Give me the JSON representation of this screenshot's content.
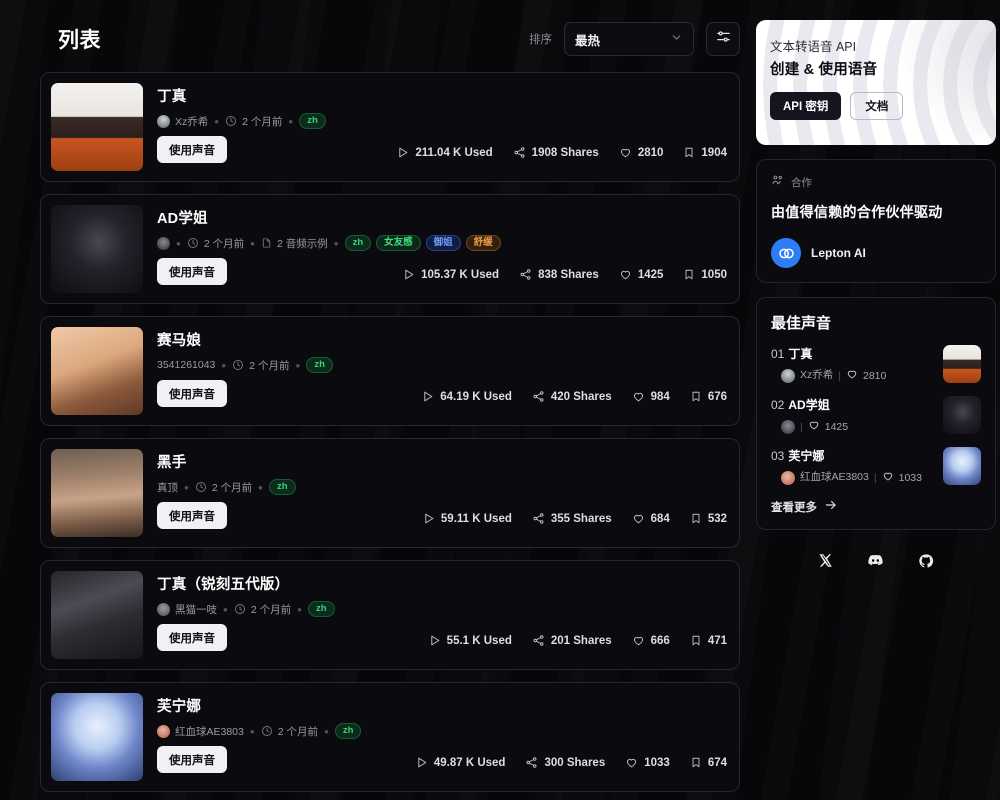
{
  "header": {
    "title": "列表",
    "sort_label": "排序",
    "sort_value": "最热",
    "chevron_icon": "chevron-down-icon",
    "filter_icon": "sliders-icon"
  },
  "list": {
    "items": [
      {
        "title": "丁真",
        "author": "Xz乔希",
        "has_author_avatar": true,
        "time": "2 个月前",
        "samples": "",
        "tags": [
          {
            "label": "zh",
            "style": "zh"
          }
        ],
        "use_button": "使用声音",
        "used": "211.04 K Used",
        "shares": "1908 Shares",
        "likes": "2810",
        "saves": "1904",
        "thumb_kind": "photo-man-orange"
      },
      {
        "title": "AD学姐",
        "author": "",
        "has_author_avatar": true,
        "time": "2 个月前",
        "samples": "2 音频示例",
        "tags": [
          {
            "label": "zh",
            "style": "zh"
          },
          {
            "label": "女友感",
            "style": "green"
          },
          {
            "label": "御姐",
            "style": "blue"
          },
          {
            "label": "舒缓",
            "style": "orange"
          }
        ],
        "use_button": "使用声音",
        "used": "105.37 K Used",
        "shares": "838 Shares",
        "likes": "1425",
        "saves": "1050",
        "thumb_kind": "anime-dark"
      },
      {
        "title": "赛马娘",
        "author": "3541261043",
        "has_author_avatar": false,
        "time": "2 个月前",
        "samples": "",
        "tags": [
          {
            "label": "zh",
            "style": "zh"
          }
        ],
        "use_button": "使用声音",
        "used": "64.19 K Used",
        "shares": "420 Shares",
        "likes": "984",
        "saves": "676",
        "thumb_kind": "anime-brown"
      },
      {
        "title": "黑手",
        "author": "真顶",
        "has_author_avatar": false,
        "time": "2 个月前",
        "samples": "",
        "tags": [
          {
            "label": "zh",
            "style": "zh"
          }
        ],
        "use_button": "使用声音",
        "used": "59.11 K Used",
        "shares": "355 Shares",
        "likes": "684",
        "saves": "532",
        "thumb_kind": "photo-man-face"
      },
      {
        "title": "丁真（锐刻五代版）",
        "author": "黑猫一吱",
        "has_author_avatar": true,
        "time": "2 个月前",
        "samples": "",
        "tags": [
          {
            "label": "zh",
            "style": "zh"
          }
        ],
        "use_button": "使用声音",
        "used": "55.1 K Used",
        "shares": "201 Shares",
        "likes": "666",
        "saves": "471",
        "thumb_kind": "photo-smoke"
      },
      {
        "title": "芙宁娜",
        "author": "红血球AE3803",
        "has_author_avatar": true,
        "time": "2 个月前",
        "samples": "",
        "tags": [
          {
            "label": "zh",
            "style": "zh"
          }
        ],
        "use_button": "使用声音",
        "used": "49.87 K Used",
        "shares": "300 Shares",
        "likes": "1033",
        "saves": "674",
        "thumb_kind": "anime-blue"
      }
    ]
  },
  "promo": {
    "subtitle": "文本转语音 API",
    "title": "创建 & 使用语音",
    "primary_button": "API 密钥",
    "secondary_button": "文档"
  },
  "partner": {
    "eyebrow": "合作",
    "eyebrow_icon": "users-icon",
    "headline": "由值得信赖的合作伙伴驱动",
    "logo_name": "lepton-logo",
    "name": "Lepton AI"
  },
  "top_voices": {
    "title": "最佳声音",
    "items": [
      {
        "rank": "01",
        "name": "丁真",
        "author": "Xz乔希",
        "has_avatar": true,
        "likes": "2810",
        "thumb_kind": "photo-man-orange"
      },
      {
        "rank": "02",
        "name": "AD学姐",
        "author": "",
        "has_avatar": true,
        "likes": "1425",
        "thumb_kind": "anime-dark"
      },
      {
        "rank": "03",
        "name": "芙宁娜",
        "author": "红血球AE3803",
        "has_avatar": true,
        "likes": "1033",
        "thumb_kind": "anime-blue"
      }
    ],
    "see_more": "查看更多",
    "see_more_icon": "arrow-right-icon"
  },
  "socials": [
    {
      "name": "x-twitter-icon"
    },
    {
      "name": "discord-icon"
    },
    {
      "name": "github-icon"
    }
  ],
  "colors": {
    "accent_green": "#36d576",
    "partner_blue": "#2d7df6",
    "card_bg": "#0b0b0f",
    "page_bg": "#07070a"
  }
}
